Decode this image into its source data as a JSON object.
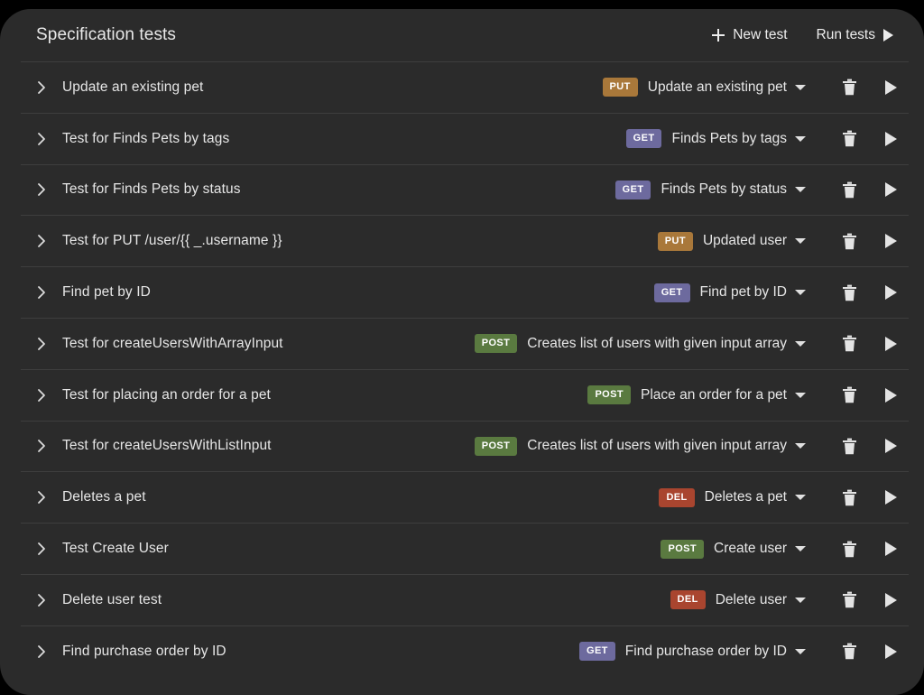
{
  "header": {
    "title": "Specification tests",
    "new_test_label": "New test",
    "run_tests_label": "Run tests",
    "new_test_icon": "plus-icon",
    "run_tests_icon": "play-icon"
  },
  "method_colors": {
    "GET": "#6d6a9e",
    "POST": "#5a7a40",
    "PUT": "#a9783a",
    "DEL": "#a9452f"
  },
  "row_icons": {
    "expand": "chevron-right-icon",
    "dropdown": "chevron-down-icon",
    "delete": "trash-icon",
    "run": "play-icon"
  },
  "tests": [
    {
      "name": "Update an existing pet",
      "method": "PUT",
      "operation": "Update an existing pet"
    },
    {
      "name": "Test for Finds Pets by tags",
      "method": "GET",
      "operation": "Finds Pets by tags"
    },
    {
      "name": "Test for Finds Pets by status",
      "method": "GET",
      "operation": "Finds Pets by status"
    },
    {
      "name": "Test for PUT /user/{{ _.username }}",
      "method": "PUT",
      "operation": "Updated user"
    },
    {
      "name": "Find pet by ID",
      "method": "GET",
      "operation": "Find pet by ID"
    },
    {
      "name": "Test for createUsersWithArrayInput",
      "method": "POST",
      "operation": "Creates list of users with given input array"
    },
    {
      "name": "Test for placing an order for a pet",
      "method": "POST",
      "operation": "Place an order for a pet"
    },
    {
      "name": "Test for createUsersWithListInput",
      "method": "POST",
      "operation": "Creates list of users with given input array"
    },
    {
      "name": "Deletes a pet",
      "method": "DEL",
      "operation": "Deletes a pet"
    },
    {
      "name": "Test Create User",
      "method": "POST",
      "operation": "Create user"
    },
    {
      "name": "Delete user test",
      "method": "DEL",
      "operation": "Delete user"
    },
    {
      "name": "Find purchase order by ID",
      "method": "GET",
      "operation": "Find purchase order by ID"
    }
  ]
}
